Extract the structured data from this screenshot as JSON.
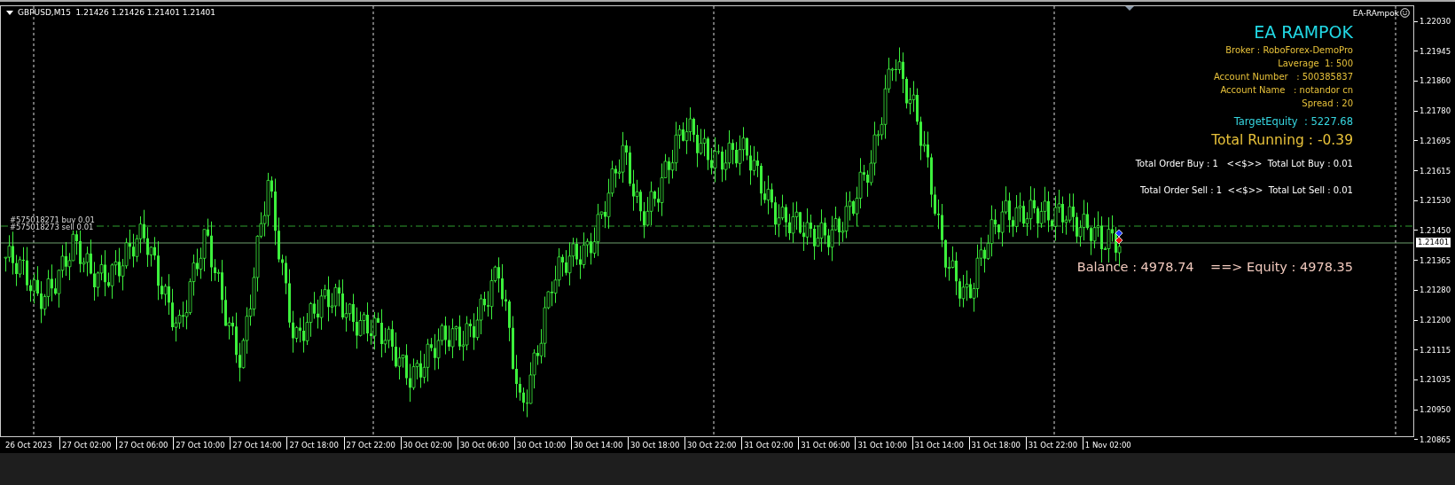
{
  "chart": {
    "symbol_header": "GBPUSD,M15  1.21426 1.21426 1.21401 1.21401",
    "expert_label": "EA-RAmpok",
    "order_labels": [
      "#575018271 buy 0.01",
      "#575018273 sell 0.01"
    ],
    "price_axis": [
      "1.22030",
      "1.21945",
      "1.21860",
      "1.21780",
      "1.21695",
      "1.21615",
      "1.21530",
      "1.21450",
      "1.21365",
      "1.21280",
      "1.21200",
      "1.21115",
      "1.21035",
      "1.20950",
      "1.20865"
    ],
    "current_price": "1.21401",
    "time_axis": [
      "26 Oct 2023",
      "27 Oct 02:00",
      "27 Oct 06:00",
      "27 Oct 10:00",
      "27 Oct 14:00",
      "27 Oct 18:00",
      "27 Oct 22:00",
      "30 Oct 02:00",
      "30 Oct 06:00",
      "30 Oct 10:00",
      "30 Oct 14:00",
      "30 Oct 18:00",
      "30 Oct 22:00",
      "31 Oct 02:00",
      "31 Oct 06:00",
      "31 Oct 10:00",
      "31 Oct 14:00",
      "31 Oct 18:00",
      "31 Oct 22:00",
      "1 Nov 02:00"
    ]
  },
  "panel": {
    "title": "EA RAMPOK",
    "info_lines": [
      "Broker : RoboForex-DemoPro",
      "Laverage  1: 500",
      "Account Number   : 500385837",
      "Account Name   : notandor cn",
      "Spread : 20"
    ],
    "target_equity": "TargetEquity  : 5227.68",
    "total_running": "Total Running : -0.39",
    "order_buy": "Total Order Buy : 1   <<$>>  Total Lot Buy : 0.01",
    "order_sell": "Total Order Sell : 1  <<$>>  Total Lot Sell : 0.01",
    "balance": "Balance : 4978.74    ==> Equity : 4978.35"
  }
}
